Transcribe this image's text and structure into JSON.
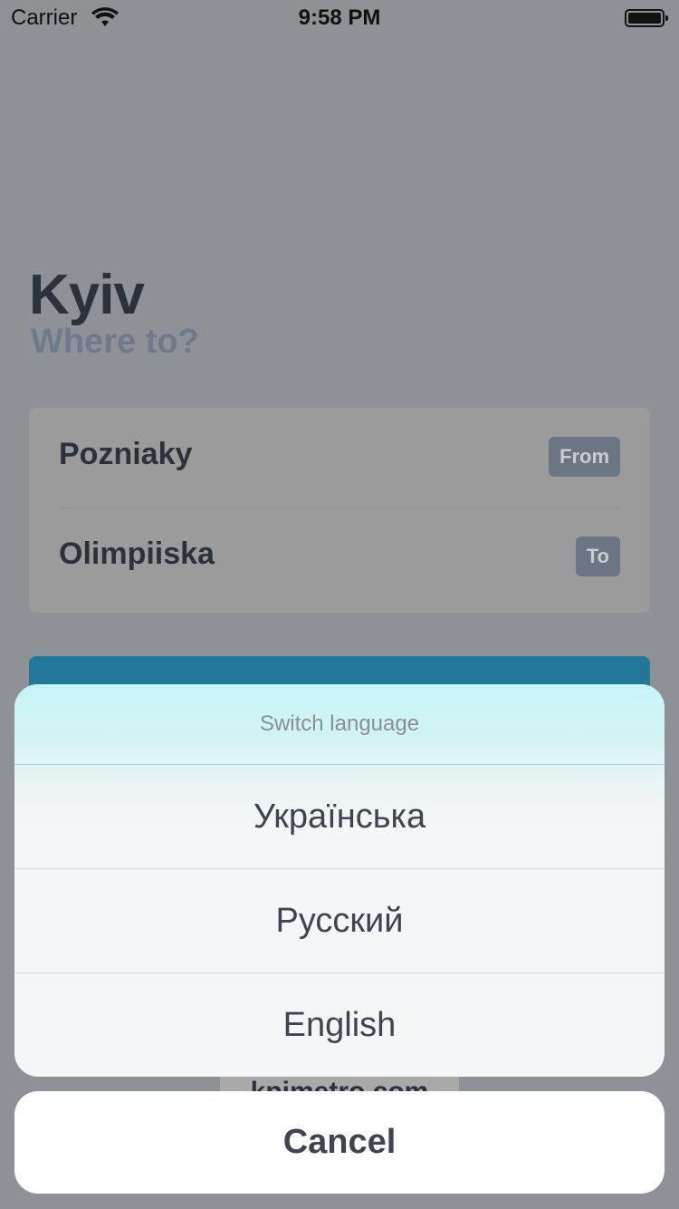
{
  "status_bar": {
    "carrier": "Carrier",
    "time": "9:58 PM"
  },
  "main": {
    "city": "Kyiv",
    "subtitle": "Where to?",
    "route": {
      "from_station": "Pozniaky",
      "from_tag": "From",
      "to_station": "Olimpiiska",
      "to_tag": "To"
    },
    "footer_text": "kpimetro.com"
  },
  "action_sheet": {
    "title": "Switch language",
    "options": [
      "Українська",
      "Русский",
      "English"
    ],
    "cancel_label": "Cancel"
  },
  "colors": {
    "accent": "#23779a",
    "header_tint": "#c6f5f7",
    "dim_background": "#8e9196"
  }
}
